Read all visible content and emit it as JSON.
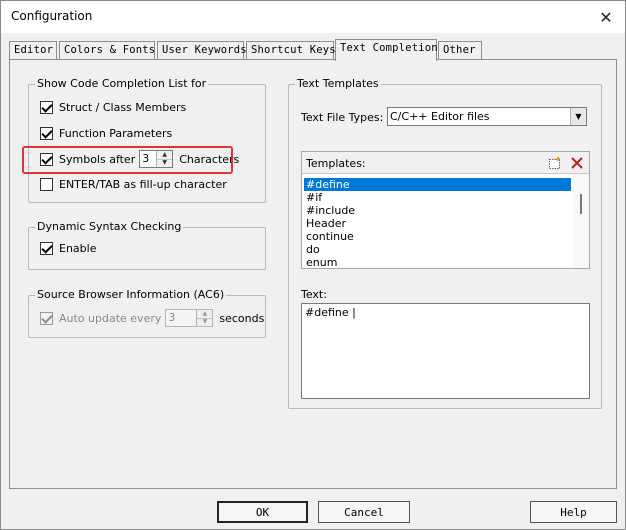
{
  "window": {
    "title": "Configuration"
  },
  "tabs": [
    {
      "label": "Editor"
    },
    {
      "label": "Colors & Fonts"
    },
    {
      "label": "User Keywords"
    },
    {
      "label": "Shortcut Keys"
    },
    {
      "label": "Text Completion",
      "active": true
    },
    {
      "label": "Other"
    }
  ],
  "code_completion": {
    "group_title": "Show Code Completion List for",
    "struct_members": {
      "label": "Struct / Class Members",
      "checked": true
    },
    "function_params": {
      "label": "Function Parameters",
      "checked": true
    },
    "symbols_after": {
      "label": "Symbols after",
      "value": "3",
      "suffix": "Characters",
      "checked": true
    },
    "enter_tab": {
      "label": "ENTER/TAB as fill-up character",
      "checked": false
    }
  },
  "dynamic_syntax": {
    "group_title": "Dynamic Syntax Checking",
    "enable": {
      "label": "Enable",
      "checked": true
    }
  },
  "source_browser": {
    "group_title": "Source Browser Information (AC6)",
    "auto_update": {
      "label": "Auto update every",
      "value": "3",
      "suffix": "seconds",
      "checked": true,
      "disabled": true
    }
  },
  "text_templates": {
    "group_title": "Text Templates",
    "file_types_label": "Text File Types:",
    "file_types_value": "C/C++ Editor files",
    "templates_label": "Templates:",
    "items": [
      "#define",
      "#if",
      "#include",
      "Header",
      "continue",
      "do",
      "enum"
    ],
    "selected_index": 0,
    "text_label": "Text:",
    "text_value": "#define |"
  },
  "buttons": {
    "ok": "OK",
    "cancel": "Cancel",
    "help": "Help"
  },
  "colors": {
    "selection": "#0078d7",
    "highlight": "#e23434"
  }
}
